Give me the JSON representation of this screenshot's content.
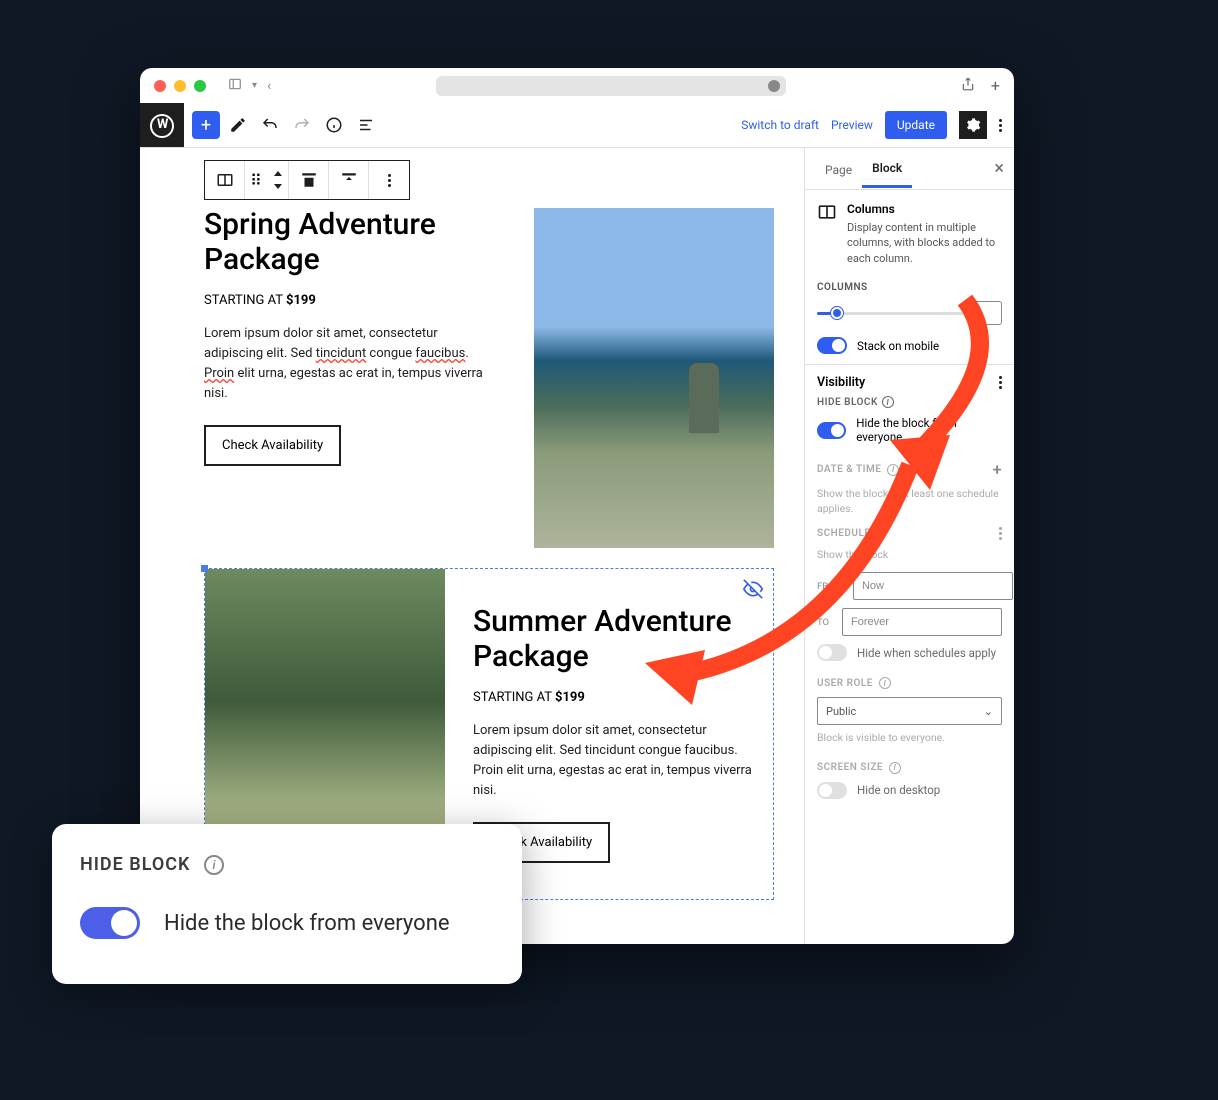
{
  "topbar": {
    "switch_to_draft": "Switch to draft",
    "preview": "Preview",
    "update": "Update"
  },
  "content": {
    "block1": {
      "title": "Spring Adventure Package",
      "starting_prefix": "STARTING AT",
      "price": "$199",
      "body_pre": "Lorem ipsum dolor sit amet, consectetur adipiscing elit. Sed ",
      "word1": "tincidunt",
      "body_mid1": " congue ",
      "word2": "faucibus",
      "body_mid2": ". ",
      "word3": "Proin",
      "body_post": " elit urna, egestas ac erat in, tempus viverra nisi.",
      "cta": "Check Availability"
    },
    "block2": {
      "title": "Summer Adventure Package",
      "starting_prefix": "STARTING AT",
      "price": "$199",
      "body": "Lorem ipsum dolor sit amet, consectetur adipiscing elit. Sed tincidunt congue faucibus. Proin elit urna, egestas ac erat in, tempus viverra nisi.",
      "cta": "Check Availability"
    }
  },
  "sidebar": {
    "tab_page": "Page",
    "tab_block": "Block",
    "block_name": "Columns",
    "block_desc": "Display content in multiple columns, with blocks added to each column.",
    "columns_label": "COLUMNS",
    "stack_label": "Stack on mobile",
    "visibility_title": "Visibility",
    "hide_block_label": "HIDE BLOCK",
    "hide_block_toggle": "Hide the block from everyone",
    "date_time_label": "DATE & TIME",
    "date_time_hint": "Show the block if at least one schedule applies.",
    "schedule_label": "SCHEDULE",
    "schedule_hint": "Show the block",
    "from_label": "FROM",
    "from_value": "Now",
    "to_label": "TO",
    "to_value": "Forever",
    "hide_schedules": "Hide when schedules apply",
    "user_role_label": "USER ROLE",
    "user_role_value": "Public",
    "user_role_hint": "Block is visible to everyone.",
    "screen_size_label": "SCREEN SIZE",
    "hide_desktop": "Hide on desktop"
  },
  "callout": {
    "label": "HIDE BLOCK",
    "text": "Hide the block from everyone"
  }
}
